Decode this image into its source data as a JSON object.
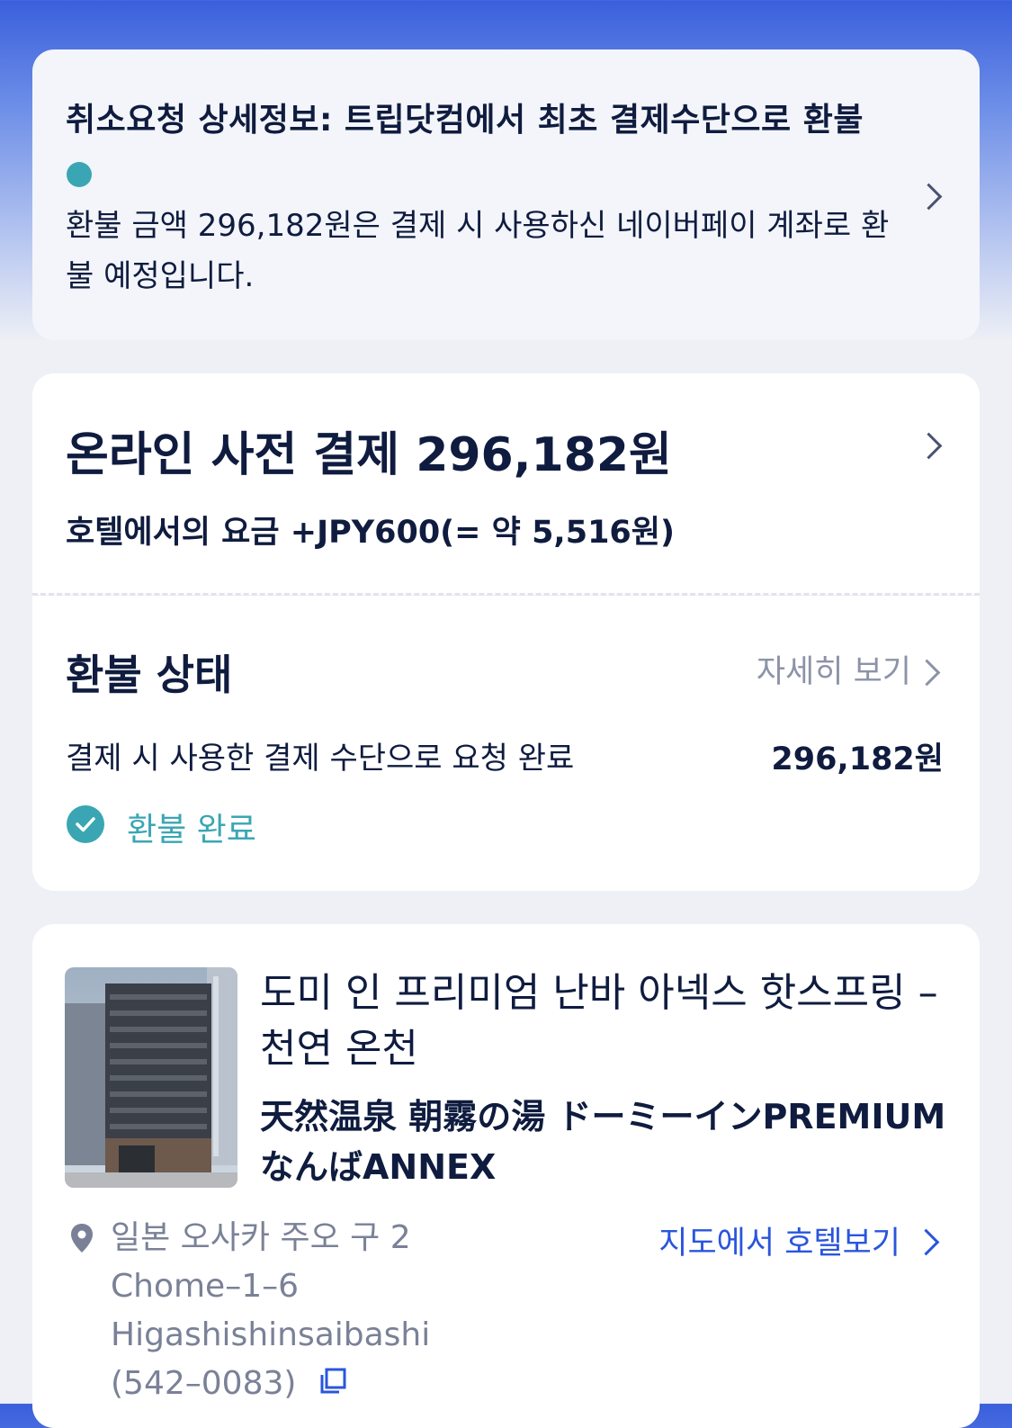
{
  "cancel_detail": {
    "title": "취소요청 상세정보: 트립닷컴에서 최초 결제수단으로 환불",
    "description": "환불 금액 296,182원은 결제 시 사용하신 네이버페이 계좌로 환불 예정입니다.",
    "dot_color": "#3aa6b3"
  },
  "payment": {
    "title": "온라인 사전 결제 296,182원",
    "hotel_fee": "호텔에서의 요금 +JPY600(= 약 5,516원)"
  },
  "refund_status": {
    "title": "환불 상태",
    "detail_link": "자세히 보기",
    "method": "결제 시 사용한 결제 수단으로 요청 완료",
    "amount": "296,182원",
    "status": "환불 완료",
    "status_color": "#3aa6b3"
  },
  "hotel": {
    "name_ko": "도미 인 프리미엄 난바 아넥스 핫스프링 – 천연 온천",
    "name_ja": "天然温泉 朝霧の湯 ドーミーインPREMIUMなんばANNEX",
    "address": "일본 오사카 주오 구 2 Chome–1–6 Higashishinsaibashi (542–0083)",
    "map_link": "지도에서 호텔보기",
    "link_color": "#2a55dc"
  }
}
